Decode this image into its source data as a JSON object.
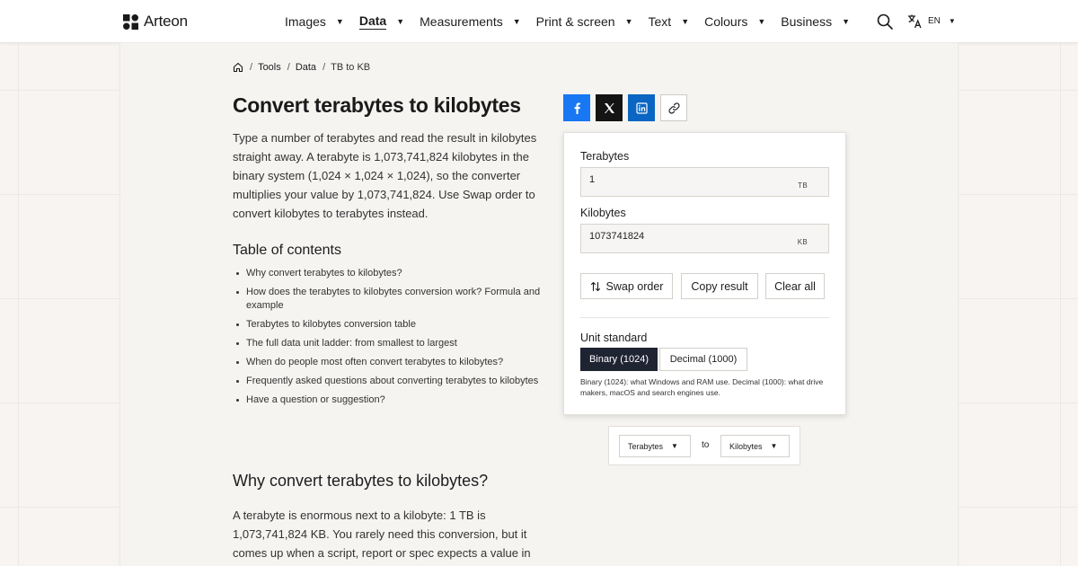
{
  "brand": {
    "name": "Arteon"
  },
  "nav": [
    {
      "label": "Images",
      "active": false
    },
    {
      "label": "Data",
      "active": true
    },
    {
      "label": "Measurements",
      "active": false
    },
    {
      "label": "Print & screen",
      "active": false
    },
    {
      "label": "Text",
      "active": false
    },
    {
      "label": "Colours",
      "active": false
    },
    {
      "label": "Business",
      "active": false
    }
  ],
  "header": {
    "lang_code": "EN",
    "search_icon": "search-icon",
    "lang_icon": "translate-icon"
  },
  "breadcrumb": {
    "items": [
      "Tools",
      "Data"
    ],
    "current": "TB to KB",
    "separator": "/"
  },
  "page": {
    "title": "Convert terabytes to kilobytes",
    "intro": "Type a number of terabytes and read the result in kilobytes straight away. A terabyte is 1,073,741,824 kilobytes in the binary system (1,024 × 1,024 × 1,024), so the converter multiplies your value by 1,073,741,824. Use Swap order to convert kilobytes to terabytes instead."
  },
  "toc": {
    "title": "Table of contents",
    "items": [
      "Why convert terabytes to kilobytes?",
      "How does the terabytes to kilobytes conversion work? Formula and example",
      "Terabytes to kilobytes conversion table",
      "The full data unit ladder: from smallest to largest",
      "When do people most often convert terabytes to kilobytes?",
      "Frequently asked questions about converting terabytes to kilobytes",
      "Have a question or suggestion?"
    ]
  },
  "section": {
    "title": "Why convert terabytes to kilobytes?",
    "body": "A terabyte is enormous next to a kilobyte: 1 TB is 1,073,741,824 KB. You rarely need this conversion, but it comes up when a script, report or spec expects a value in"
  },
  "converter": {
    "from_label": "Terabytes",
    "from_value": "1",
    "from_unit": "TB",
    "to_label": "Kilobytes",
    "to_value": "1073741824",
    "to_unit": "KB",
    "swap_label": "Swap order",
    "copy_label": "Copy result",
    "clear_label": "Clear all",
    "standard_label": "Unit standard",
    "binary_label": "Binary (1024)",
    "decimal_label": "Decimal (1000)",
    "standard_selected": "binary",
    "standard_note": "Binary (1024): what Windows and RAM use. Decimal (1000): what drive makers, macOS and search engines use."
  },
  "unit_selector": {
    "from": "Terabytes",
    "connector": "to",
    "to": "Kilobytes"
  },
  "colors": {
    "facebook": "#1877f2",
    "x": "#141414",
    "linkedin": "#0a66c2",
    "segment_active": "#1f2433",
    "page_bg": "#f7f4f1"
  }
}
